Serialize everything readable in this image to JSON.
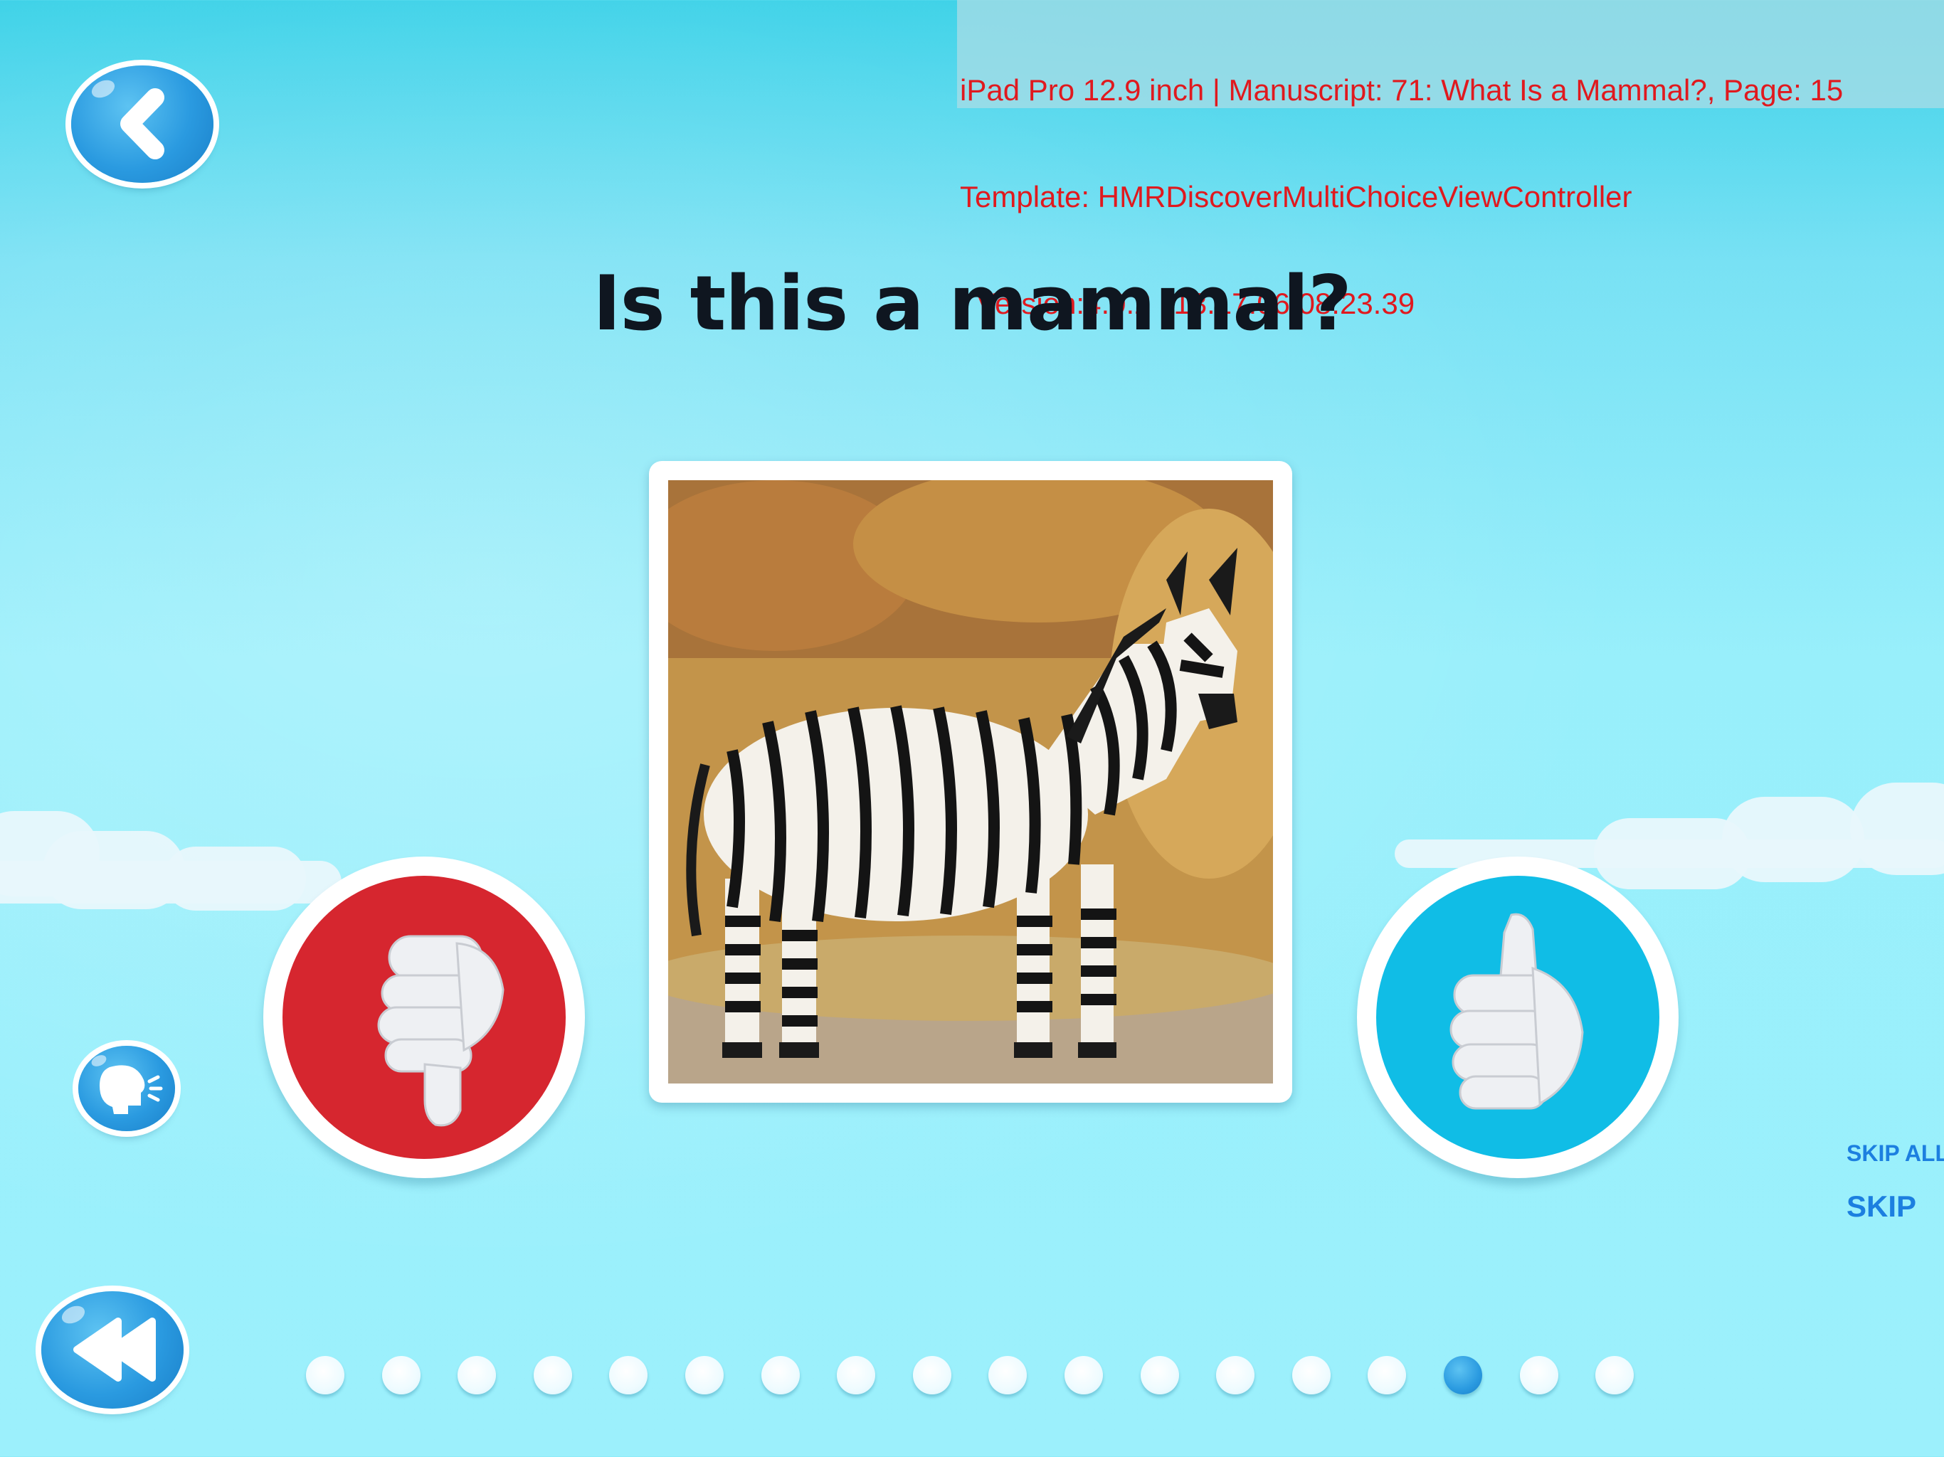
{
  "debug": {
    "line1": "iPad Pro 12.9 inch | Manuscript: 71: What Is a Mammal?, Page: 15",
    "line2": "Template: HMRDiscoverMultiChoiceViewController",
    "line3": ", Version:4.0.2 113.17.06.08.23.39"
  },
  "question": {
    "title": "Is this a mammal?"
  },
  "photo": {
    "subject": "zebra"
  },
  "answers": {
    "no_icon": "thumbs-down-icon",
    "yes_icon": "thumbs-up-icon"
  },
  "nav": {
    "back_icon": "chevron-left-icon",
    "speak_icon": "speaking-head-icon",
    "rewind_icon": "rewind-icon"
  },
  "skip": {
    "skip_all_label": "SKIP ALL",
    "skip_label": "SKIP"
  },
  "pagination": {
    "total": 18,
    "current": 16
  },
  "colors": {
    "no": "#d6262f",
    "yes": "#10bde6",
    "accent": "#2a9ae0",
    "skip_text": "#1c7fe0"
  }
}
